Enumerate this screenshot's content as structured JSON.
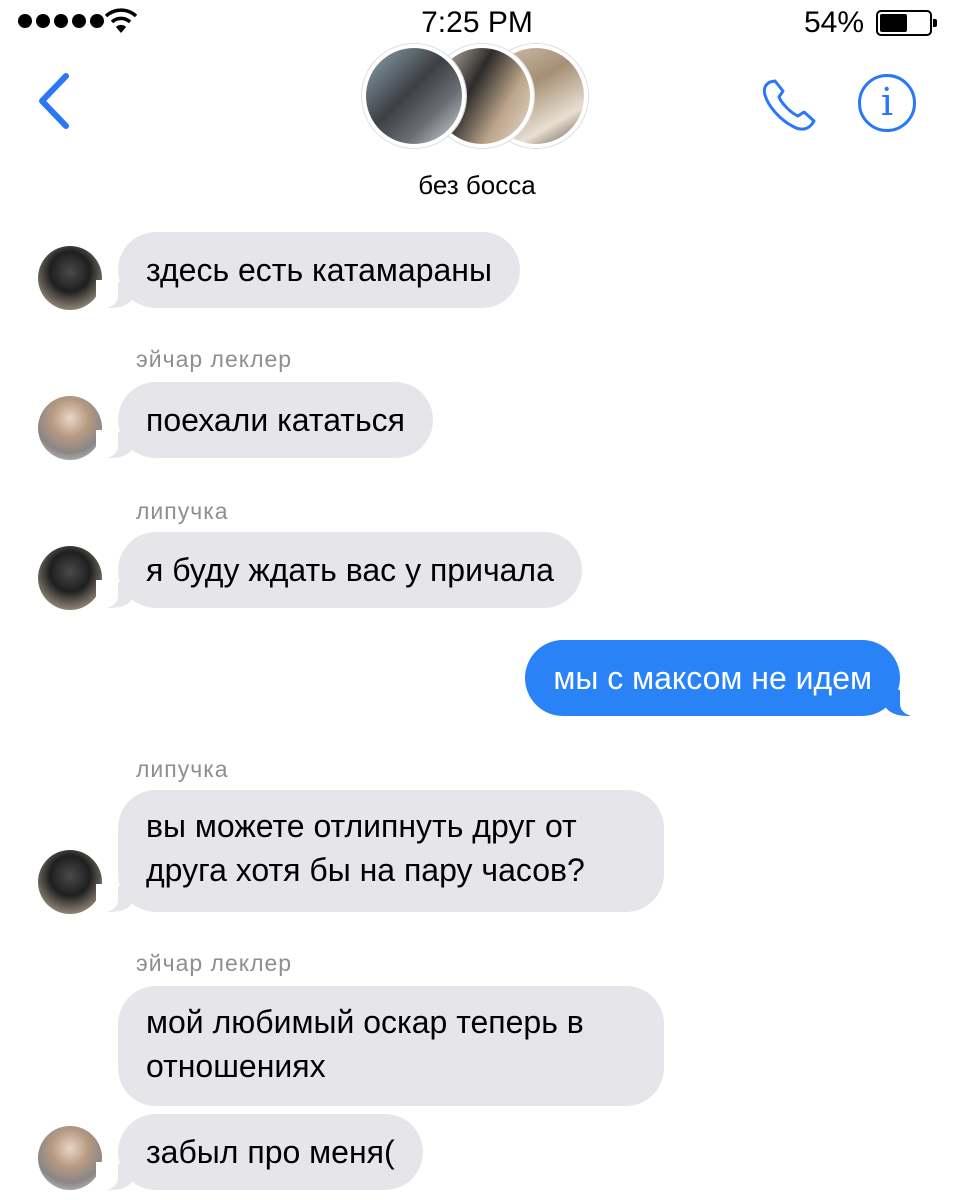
{
  "status_bar": {
    "time": "7:25 PM",
    "battery_percent": "54%",
    "battery_level": 0.54,
    "signal_bars": 5
  },
  "header": {
    "title": "без босса",
    "accent_color": "#2a78f5",
    "info_label": "i"
  },
  "messages": [
    {
      "sender": "",
      "text": "здесь есть катамараны",
      "direction": "incoming"
    },
    {
      "sender": "эйчар леклер",
      "text": "поехали кататься",
      "direction": "incoming"
    },
    {
      "sender": "липучка",
      "text": "я буду ждать вас у причала",
      "direction": "incoming"
    },
    {
      "sender": "",
      "text": "мы с максом не идем",
      "direction": "outgoing"
    },
    {
      "sender": "липучка",
      "text": "вы можете отлипнуть друг от друга хотя бы на пару часов?",
      "direction": "incoming"
    },
    {
      "sender": "эйчар леклер",
      "text": "мой любимый оскар теперь в отношениях",
      "direction": "incoming"
    },
    {
      "sender": "",
      "text": "забыл про меня(",
      "direction": "incoming"
    }
  ],
  "colors": {
    "incoming_bubble": "#e6e6ea",
    "outgoing_bubble": "#2a82f7",
    "sender_name": "#8e8e93"
  }
}
